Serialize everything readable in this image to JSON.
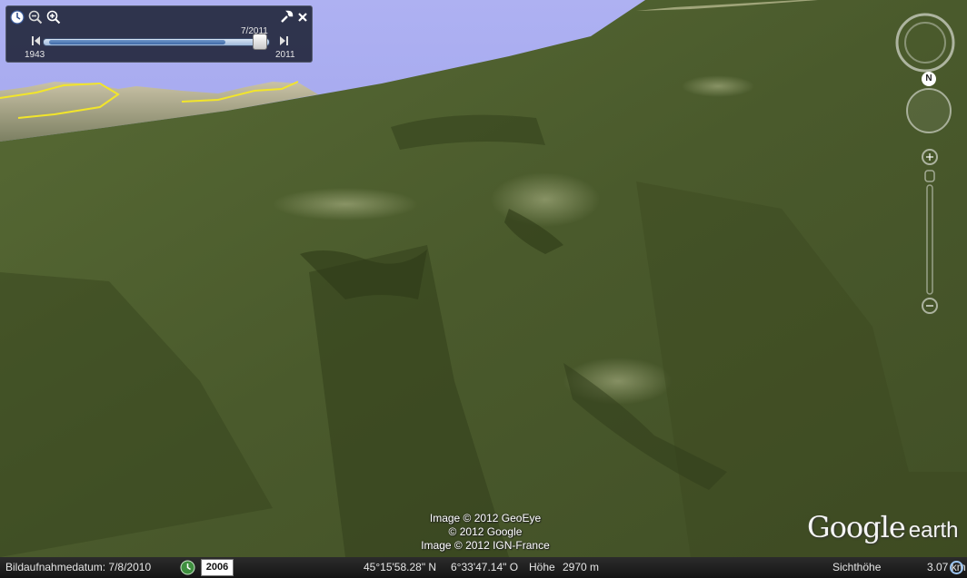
{
  "app": {
    "name": "Google Earth",
    "logo_google": "Google",
    "logo_earth": "earth"
  },
  "time_slider": {
    "current": "7/2011",
    "start": "1943",
    "end": "2011",
    "position_fraction": 0.96
  },
  "attribution": [
    "Image © 2012 GeoEye",
    "© 2012 Google",
    "Image © 2012 IGN-France"
  ],
  "navigation": {
    "north_label": "N"
  },
  "status_bar": {
    "imagery_date_label": "Bildaufnahmedatum: 7/8/2010",
    "historical_year": "2006",
    "latitude": "45°15'58.28\" N",
    "longitude": "6°33'47.14\" O",
    "elevation_label": "Höhe",
    "elevation": "2970 m",
    "eye_altitude_label": "Sichthöhe",
    "eye_altitude": "3.07 km"
  },
  "colors": {
    "sky": "#9fa3ee",
    "terrain": "#4e5f30",
    "border_line": "#f2e52a",
    "panel": "#14182a"
  },
  "icons": [
    "clock-icon",
    "zoom-out-icon",
    "zoom-in-icon",
    "wrench-icon",
    "close-icon",
    "look-joystick-icon",
    "move-joystick-icon",
    "zoom-slider-icon",
    "historical-imagery-icon",
    "streaming-status-icon"
  ]
}
